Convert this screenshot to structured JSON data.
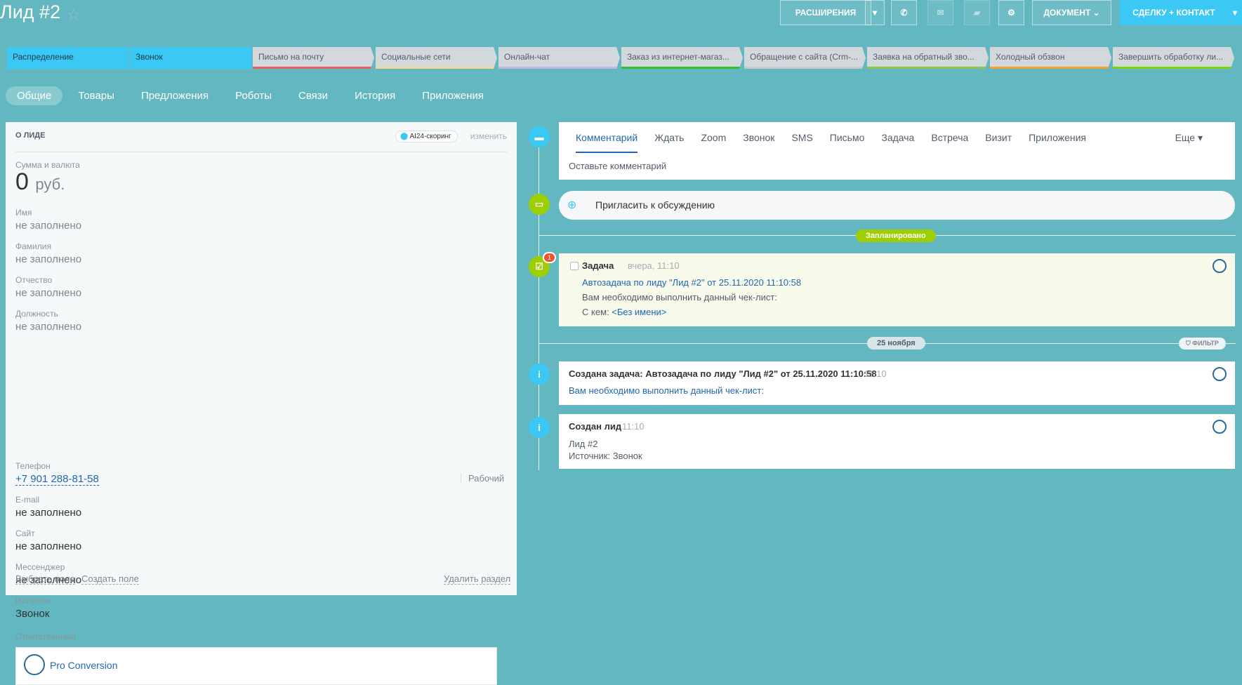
{
  "header": {
    "title": "Лид #2",
    "extensions": "РАСШИРЕНИЯ",
    "document": "ДОКУМЕНТ",
    "deal_contact": "СДЕЛКУ + КОНТАКТ"
  },
  "stages": [
    {
      "label": "Распределение",
      "color": "#3bc8f5",
      "active": true
    },
    {
      "label": "Звонок",
      "color": "#3bc8f5",
      "active": true
    },
    {
      "label": "Письмо на почту",
      "color": "#e55f5f",
      "active": false
    },
    {
      "label": "Социальные сети",
      "color": "#f0d89a",
      "active": false
    },
    {
      "label": "Онлайн-чат",
      "color": "#c7b3ea",
      "active": false
    },
    {
      "label": "Заказ из интернет-магаз...",
      "color": "#2fc22f",
      "active": false
    },
    {
      "label": "Обращение с сайта (Crm-...",
      "color": "#c4c9cc",
      "active": false
    },
    {
      "label": "Заявка на обратный зво...",
      "color": "#8fc34a",
      "active": false
    },
    {
      "label": "Холодный обзвон",
      "color": "#f0a22f",
      "active": false
    },
    {
      "label": "Завершить обработку ли...",
      "color": "#7bd500",
      "active": false
    }
  ],
  "tabs": [
    "Общие",
    "Товары",
    "Предложения",
    "Роботы",
    "Связи",
    "История",
    "Приложения"
  ],
  "about": {
    "title": "О ЛИДЕ",
    "scoring": "AI24-скоринг",
    "edit": "изменить",
    "sum_label": "Сумма и валюта",
    "sum_value": "0",
    "currency": "руб.",
    "fields": [
      {
        "label": "Имя",
        "value": "не заполнено"
      },
      {
        "label": "Фамилия",
        "value": "не заполнено"
      },
      {
        "label": "Отчество",
        "value": "не заполнено"
      },
      {
        "label": "Должность",
        "value": "не заполнено"
      }
    ],
    "phone_label": "Телефон",
    "phone": "+7 901 288-81-58",
    "phone_type": "Рабочий",
    "fields2": [
      {
        "label": "E-mail",
        "value": "не заполнено"
      },
      {
        "label": "Сайт",
        "value": "не заполнено"
      },
      {
        "label": "Мессенджер",
        "value": "не заполнено"
      },
      {
        "label": "Источник",
        "value": "Звонок"
      }
    ],
    "responsible_label": "Ответственный",
    "responsible": "Pro Conversion",
    "select_field": "Выбрать поле",
    "create_field": "Создать поле",
    "delete_section": "Удалить раздел"
  },
  "timeline": {
    "tabs": [
      "Комментарий",
      "Ждать",
      "Zoom",
      "Звонок",
      "SMS",
      "Письмо",
      "Задача",
      "Встреча",
      "Визит",
      "Приложения"
    ],
    "more": "Еще",
    "comment_placeholder": "Оставьте комментарий",
    "invite": "Пригласить к обсуждению",
    "planned": "Запланировано",
    "task": {
      "title": "Задача",
      "time": "вчера, 11:10",
      "badge": "1",
      "link": "Автозадача по лиду \"Лид #2\" от 25.11.2020 11:10:58",
      "text": "Вам необходимо выполнить данный чек-лист:",
      "with_label": "С кем:",
      "with": "<Без имени>"
    },
    "date": "25 ноября",
    "filter": "ФИЛЬТР",
    "created_task": {
      "title": "Создана задача: Автозадача по лиду \"Лид #2\" от 25.11.2020 11:10:58",
      "time": "11:10",
      "text": "Вам необходимо выполнить данный чек-лист:"
    },
    "created_lead": {
      "title": "Создан лид",
      "time": "11:10",
      "line1": "Лид #2",
      "line2": "Источник: Звонок"
    }
  }
}
